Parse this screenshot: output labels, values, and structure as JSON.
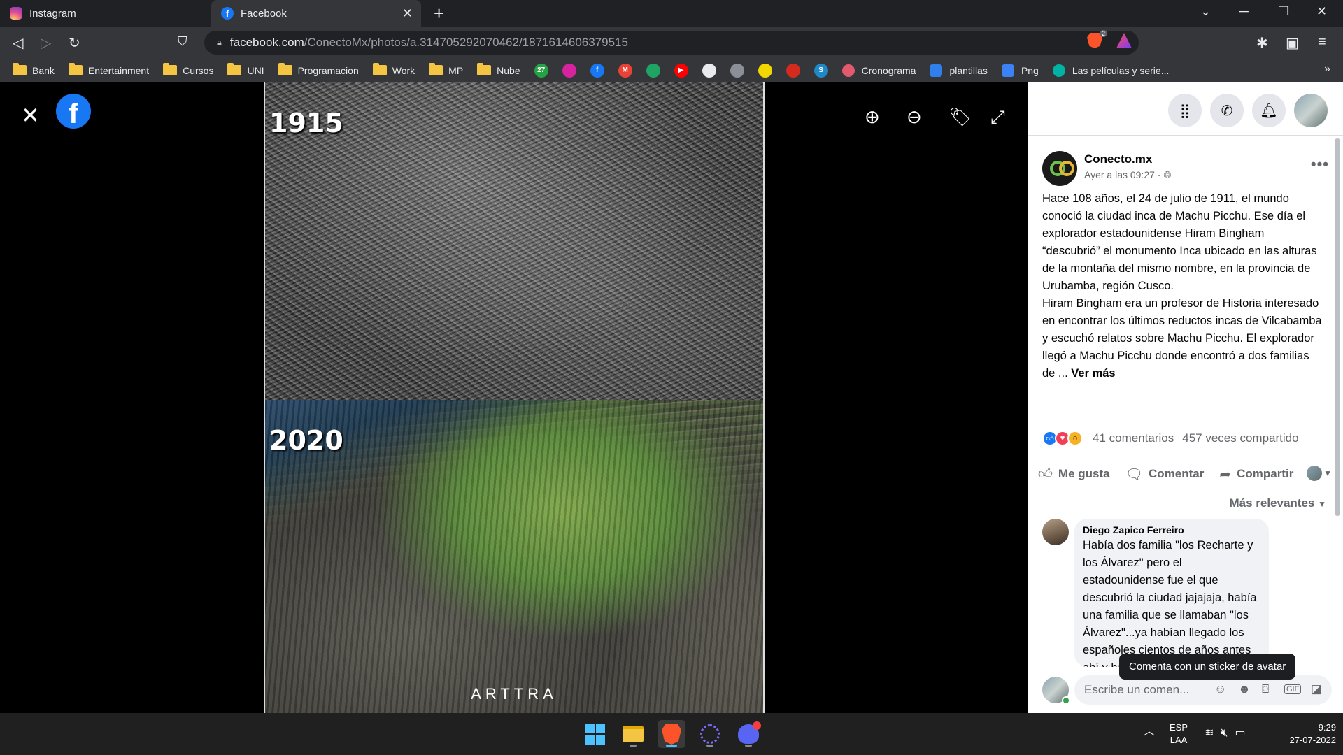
{
  "browser": {
    "tabs": [
      {
        "title": "Instagram",
        "active": false
      },
      {
        "title": "Facebook",
        "active": true
      }
    ],
    "url_host": "facebook.com",
    "url_path": "/ConectoMx/photos/a.314705292070462/1871614606379515",
    "brave_badge": "2",
    "bookmarks": [
      {
        "label": "Bank",
        "type": "folder"
      },
      {
        "label": "Entertainment",
        "type": "folder"
      },
      {
        "label": "Cursos",
        "type": "folder"
      },
      {
        "label": "UNI",
        "type": "folder"
      },
      {
        "label": "Programacion",
        "type": "folder"
      },
      {
        "label": "Work",
        "type": "folder"
      },
      {
        "label": "MP",
        "type": "folder"
      },
      {
        "label": "Nube",
        "type": "folder"
      }
    ],
    "bookmark_icons": [
      {
        "name": "bm-badge-27-icon",
        "color": "#25a244",
        "text": "27"
      },
      {
        "name": "bm-instagram-icon",
        "color": "#d6249f",
        "text": ""
      },
      {
        "name": "bm-facebook-icon",
        "color": "#1877f2",
        "text": "f"
      },
      {
        "name": "bm-gmail-icon",
        "color": "#ea4335",
        "text": "M"
      },
      {
        "name": "bm-drive-icon",
        "color": "#1fa463",
        "text": ""
      },
      {
        "name": "bm-youtube-icon",
        "color": "#ff0000",
        "text": "▶"
      },
      {
        "name": "bm-github-icon",
        "color": "#e8eaed",
        "text": ""
      },
      {
        "name": "bm-globe-icon",
        "color": "#8a8f98",
        "text": ""
      },
      {
        "name": "bm-yellow-icon",
        "color": "#f1d600",
        "text": ""
      },
      {
        "name": "bm-maple-icon",
        "color": "#d52b1e",
        "text": ""
      },
      {
        "name": "bm-s-icon",
        "color": "#1e88c8",
        "text": "S"
      }
    ],
    "bookmark_links": [
      {
        "label": "Cronograma",
        "color": "#e35a6f"
      },
      {
        "label": "plantillas",
        "color": "#2f80ed"
      },
      {
        "label": "Png",
        "color": "#3b82f6"
      },
      {
        "label": "Las películas y serie...",
        "color": "#00b3a4"
      }
    ],
    "bookmarks_more": "»"
  },
  "viewer": {
    "year_top": "1915",
    "year_bottom": "2020",
    "watermark": "ARTTRA"
  },
  "post": {
    "page_name": "Conecto.mx",
    "time": "Ayer a las 09:27 ·",
    "paragraph1": "Hace 108 años, el 24 de julio de 1911, el mundo conoció la ciudad inca de Machu Picchu. Ese día el explorador estadounidense Hiram Bingham “descubrió” el monumento Inca ubicado en las alturas de la montaña del mismo nombre, en la provincia de Urubamba, región Cusco.",
    "paragraph2": "Hiram Bingham era un profesor de Historia interesado en encontrar los últimos reductos incas de Vilcabamba y escuchó relatos sobre Machu Picchu. El explorador llegó a Machu Picchu donde encontró a dos familias de ...",
    "see_more": "Ver más",
    "comments_count": "41 comentarios",
    "shares_count": "457 veces compartido",
    "actions": {
      "like": "Me gusta",
      "comment": "Comentar",
      "share": "Compartir"
    },
    "sort": "Más relevantes",
    "comment": {
      "author": "Diego Zapico Ferreiro",
      "text": "Había dos familia \"los Recharte y los Álvarez\" pero el estadounidense fue el que descubrió la ciudad jajajaja, había una familia que se llamaban \"los Álvarez\"...ya habían llegado los españoles cientos de años antes ahí y habían dejado familias"
    },
    "tooltip": "Comenta con un sticker de avatar",
    "composer_placeholder": "Escribe un comen..."
  },
  "taskbar": {
    "lang_top": "ESP",
    "lang_bottom": "LAA",
    "time": "9:29",
    "date": "27-07-2022"
  }
}
